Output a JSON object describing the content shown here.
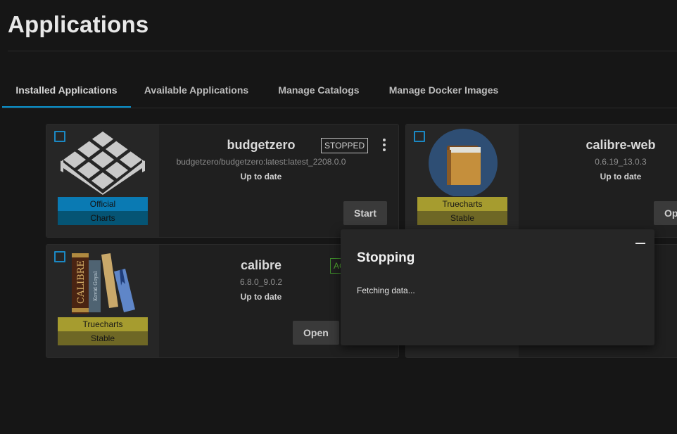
{
  "page": {
    "title": "Applications"
  },
  "tabs": [
    {
      "label": "Installed Applications",
      "active": true
    },
    {
      "label": "Available Applications"
    },
    {
      "label": "Manage Catalogs"
    },
    {
      "label": "Manage Docker Images"
    }
  ],
  "apps": [
    {
      "name": "budgetzero",
      "version": "budgetzero/budgetzero:latest:latest_2208.0.0",
      "update": "Up to date",
      "status": "STOPPED",
      "badge_top": "Official",
      "badge_bottom": "Charts",
      "action": "Start",
      "icon": "budgetzero-logo-icon"
    },
    {
      "name": "calibre-web",
      "version": "0.6.19_13.0.3",
      "update": "Up to date",
      "badge_top": "Truecharts",
      "badge_bottom": "Stable",
      "action": "Op",
      "icon": "book-icon"
    },
    {
      "name": "calibre",
      "version": "6.8.0_9.0.2",
      "update": "Up to date",
      "status": "AC",
      "badge_top": "Truecharts",
      "badge_bottom": "Stable",
      "action": "Open",
      "icon": "calibre-books-icon"
    }
  ],
  "dialog": {
    "title": "Stopping",
    "message": "Fetching data..."
  },
  "colors": {
    "accent": "#0a95d1",
    "official": "#0a7ab3",
    "truecharts": "#a69c2f",
    "active": "#4fa42f"
  }
}
